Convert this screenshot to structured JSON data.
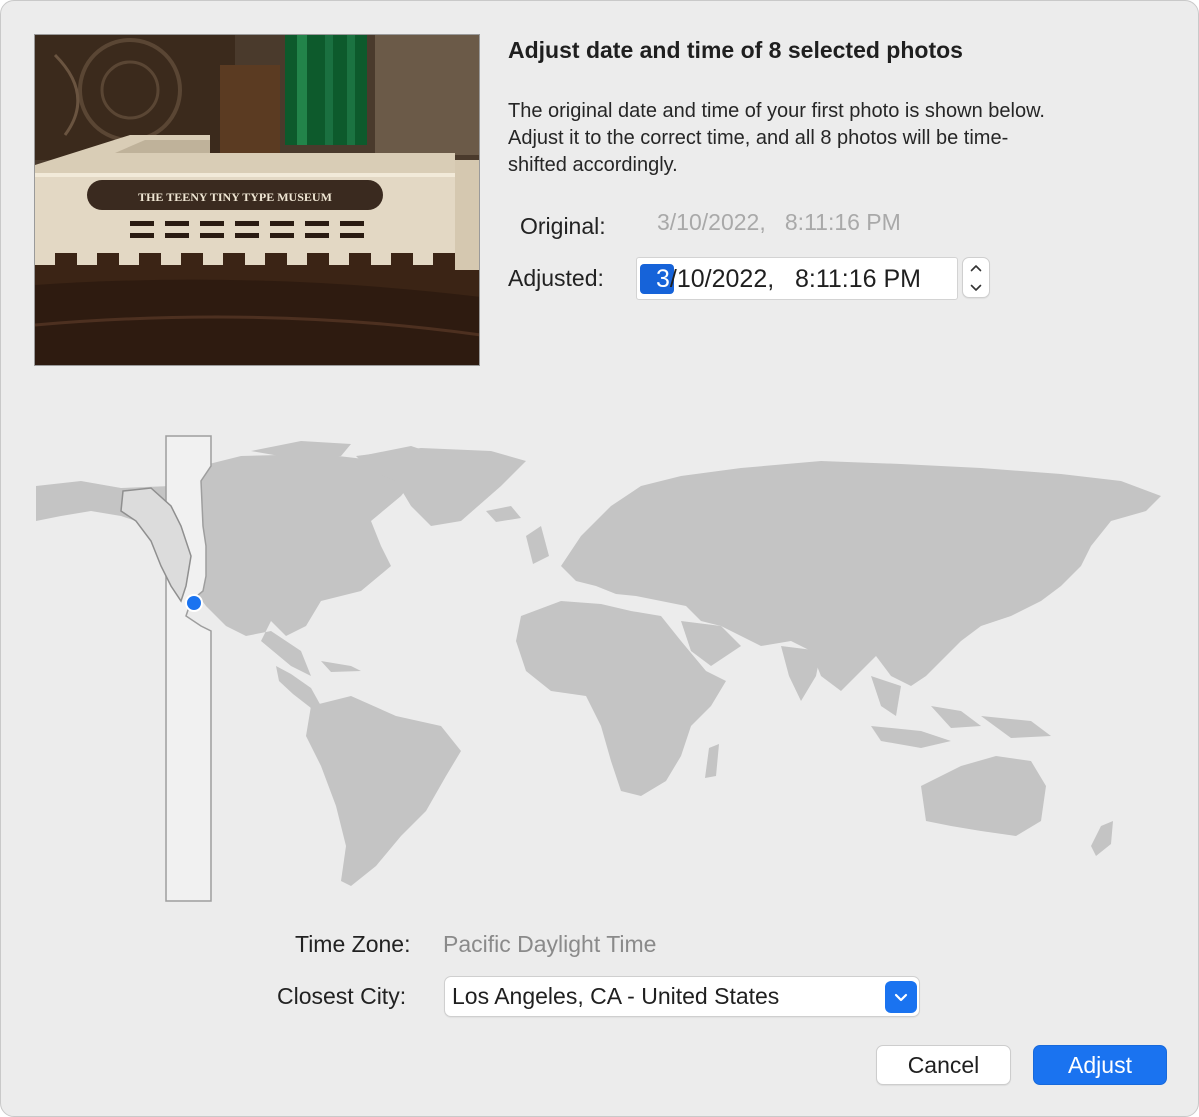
{
  "photo": {
    "sign_text": "THE TEENY TINY TYPE MUSEUM"
  },
  "header": {
    "title": "Adjust date and time of 8 selected photos",
    "description_lines": [
      "The original date and time of your first photo is shown below.",
      "Adjust it to the correct time, and all 8 photos will be time-",
      "shifted accordingly."
    ]
  },
  "original": {
    "label": "Original:",
    "value": "3/10/2022,   8:11:16 PM"
  },
  "adjusted": {
    "label": "Adjusted:",
    "selected_segment": "3",
    "rest": "/10/2022,   8:11:16 PM"
  },
  "time_zone": {
    "label": "Time Zone:",
    "value": "Pacific Daylight Time"
  },
  "closest_city": {
    "label": "Closest City:",
    "value": "Los Angeles, CA - United States"
  },
  "buttons": {
    "cancel": "Cancel",
    "adjust": "Adjust"
  },
  "colors": {
    "accent": "#1a73f0",
    "selection": "#1663d9",
    "land": "#c4c4c4",
    "highlighted_zone": "#e3e3e3",
    "location_pin": "#1a73f0"
  },
  "icons": {
    "stepper_up": "chevron-up-icon",
    "stepper_down": "chevron-down-icon",
    "select": "chevron-down-icon",
    "location": "location-pin-icon"
  }
}
